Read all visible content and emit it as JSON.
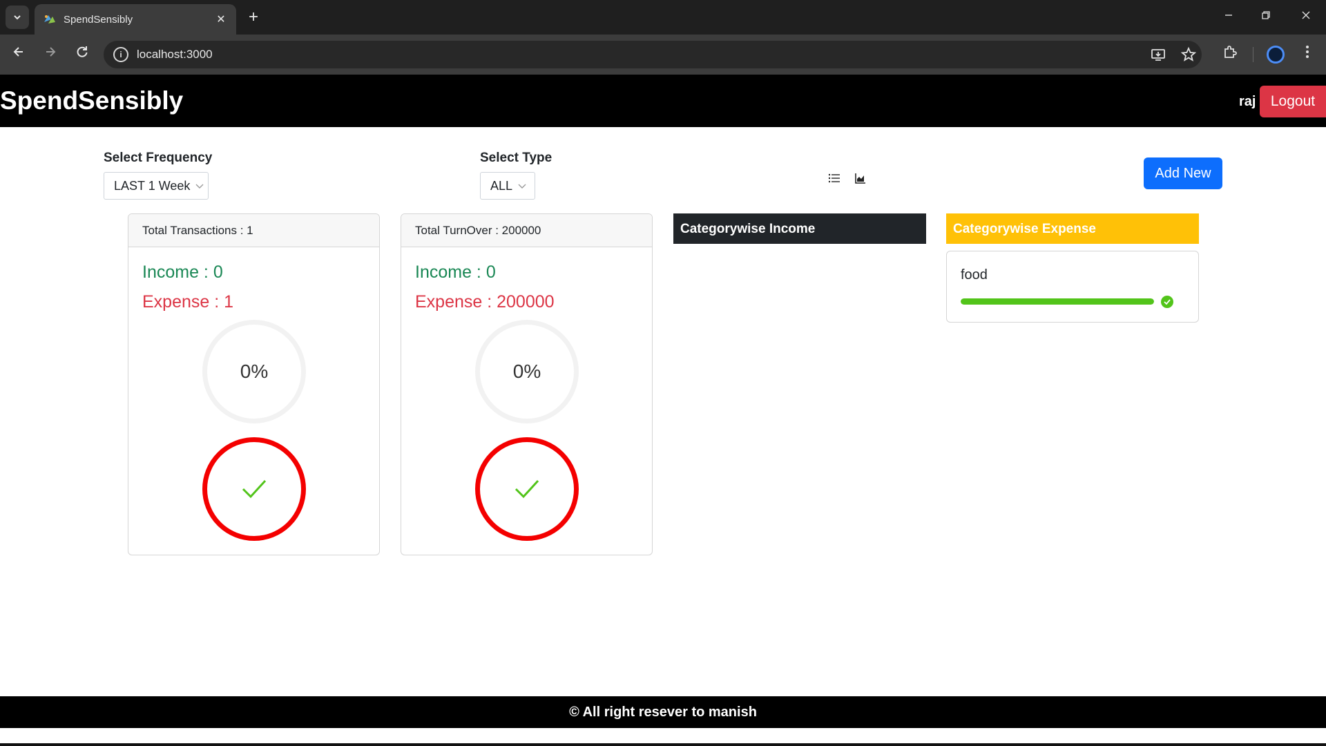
{
  "browser": {
    "tab_title": "SpendSensibly",
    "tab_close": "✕",
    "new_tab": "+",
    "url": "localhost:3000"
  },
  "header": {
    "brand": "SpendSensibly",
    "username": "raj",
    "logout_label": "Logout"
  },
  "filters": {
    "frequency_label": "Select Frequency",
    "frequency_value": "LAST 1 Week",
    "type_label": "Select Type",
    "type_value": "ALL",
    "add_new_label": "Add New"
  },
  "cards": [
    {
      "header": "Total Transactions : 1",
      "income": "Income : 0",
      "expense": "Expense : 1",
      "percent": "0%"
    },
    {
      "header": "Total TurnOver : 200000",
      "income": "Income : 0",
      "expense": "Expense : 200000",
      "percent": "0%"
    }
  ],
  "categories": {
    "income_title": "Categorywise Income",
    "expense_title": "Categorywise Expense",
    "expense_items": [
      {
        "name": "food",
        "percent": 100
      }
    ]
  },
  "colors": {
    "income": "#198754",
    "expense": "#dc3545",
    "ring_red": "#f40000",
    "check_green": "#52c41a",
    "expense_header": "#ffc107",
    "add_button": "#0d6efd"
  },
  "footer": {
    "text": "© All right resever to manish"
  }
}
